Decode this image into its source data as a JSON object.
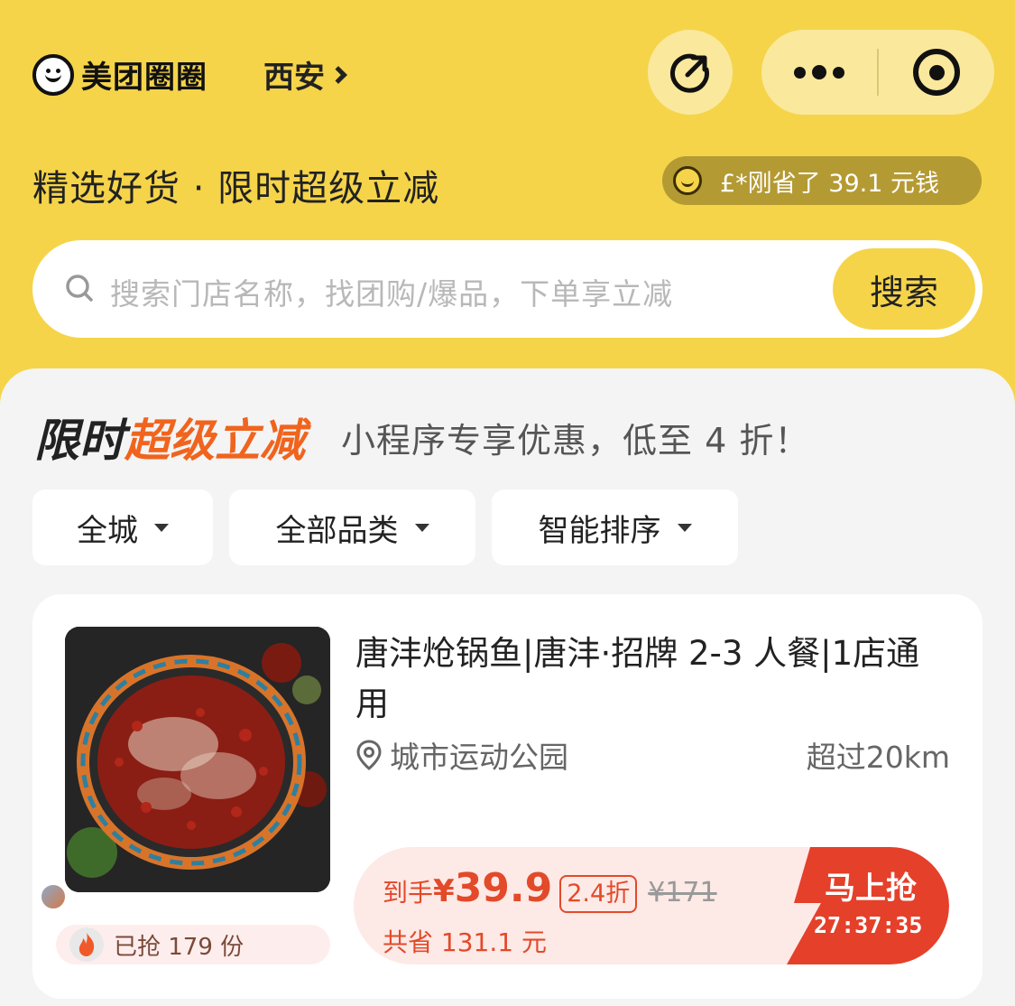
{
  "header": {
    "brand": "美团圈圈",
    "city": "西安"
  },
  "banner": {
    "slogan": "精选好货 · 限时超级立减",
    "saver_text": "£*刚省了 39.1 元钱"
  },
  "search": {
    "placeholder": "搜索门店名称，找团购/爆品，下单享立减",
    "button": "搜索"
  },
  "promo": {
    "title_black": "限时",
    "title_orange": "超级立减",
    "subtitle": "小程序专享优惠，低至 4 折！"
  },
  "filters": [
    {
      "label": "全城"
    },
    {
      "label": "全部品类"
    },
    {
      "label": "智能排序"
    }
  ],
  "deal": {
    "title": "唐沣炝锅鱼|唐沣·招牌 2-3 人餐|1店通用",
    "location": "城市运动公园",
    "distance": "超过20km",
    "grabbed": "已抢 179 份",
    "price_prefix": "到手",
    "currency": "¥",
    "price": "39.9",
    "discount": "2.4折",
    "original_price": "¥171",
    "saved": "共省 131.1 元",
    "cta": "马上抢",
    "countdown": "27:37:35"
  },
  "colors": {
    "brand_yellow": "#f5d44a",
    "accent_orange": "#f0641e",
    "price_red": "#e24a2a",
    "cta_red": "#e5402a"
  }
}
